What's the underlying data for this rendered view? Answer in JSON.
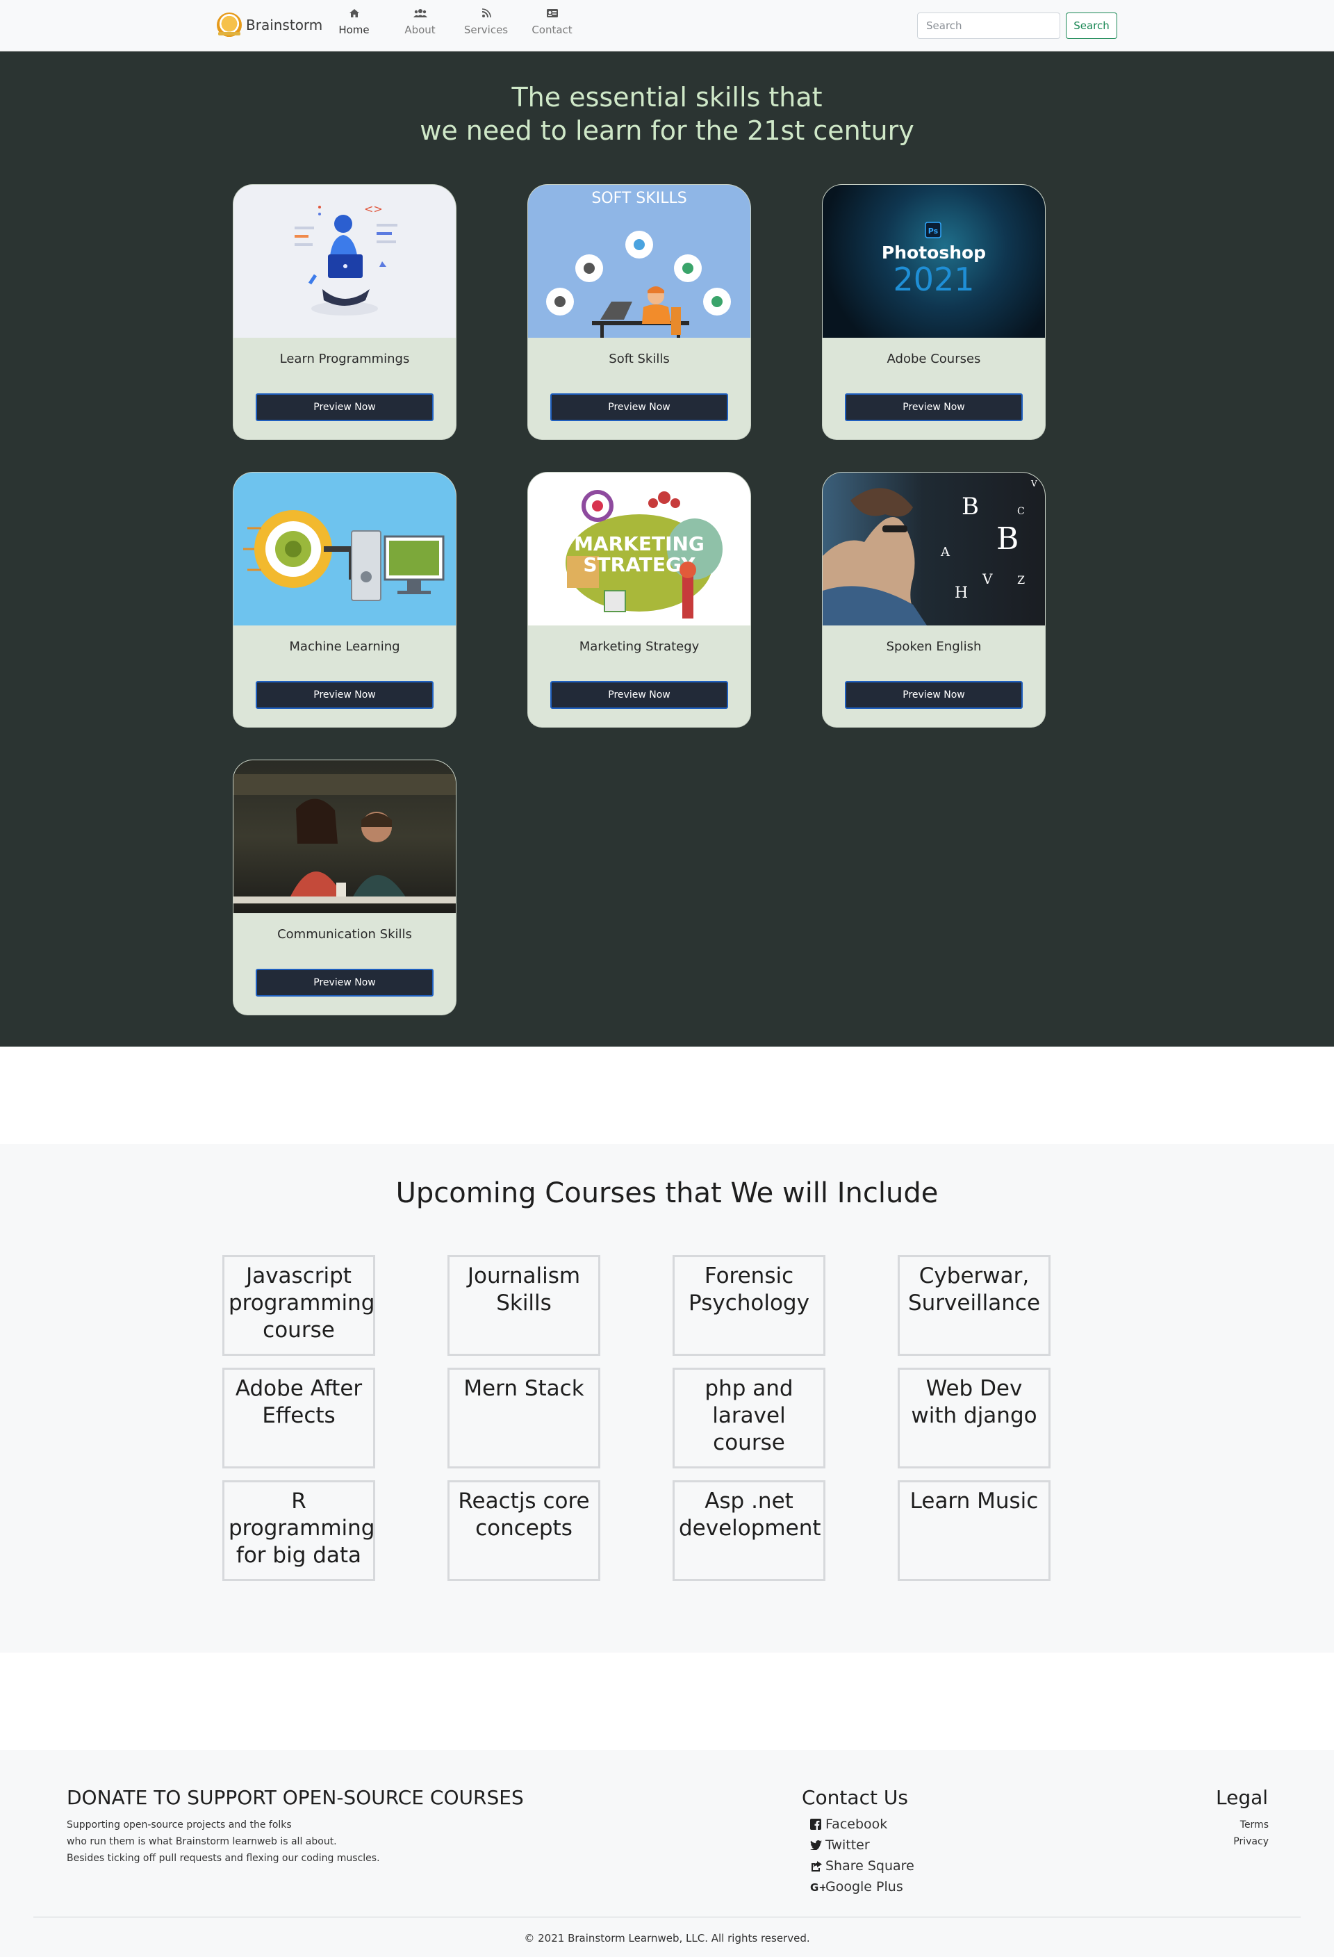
{
  "nav": {
    "brand": "Brainstorm",
    "items": [
      {
        "label": "Home",
        "icon": "home-icon"
      },
      {
        "label": "About",
        "icon": "users-icon"
      },
      {
        "label": "Services",
        "icon": "broadcast-icon"
      },
      {
        "label": "Contact",
        "icon": "id-card-icon"
      }
    ],
    "search_placeholder": "Search",
    "search_button": "Search"
  },
  "hero": {
    "title_line1": "The essential skills that",
    "title_line2": "we need to learn for the 21st century",
    "cards": [
      {
        "title": "Learn Programmings",
        "button": "Preview Now"
      },
      {
        "title": "Soft Skills",
        "button": "Preview Now",
        "image_text": "SOFT  SKILLS"
      },
      {
        "title": "Adobe Courses",
        "button": "Preview Now",
        "image_text_1": "Ps",
        "image_text_2": "Photoshop",
        "image_text_3": "2021"
      },
      {
        "title": "Machine Learning",
        "button": "Preview Now"
      },
      {
        "title": "Marketing Strategy",
        "button": "Preview Now",
        "image_text_1": "MARKETING",
        "image_text_2": "STRATEGY"
      },
      {
        "title": "Spoken English",
        "button": "Preview Now"
      },
      {
        "title": "Communication Skills",
        "button": "Preview Now"
      }
    ]
  },
  "upcoming": {
    "title": "Upcoming Courses that We will Include",
    "courses": [
      "Javascript programming course",
      "Journalism Skills",
      "Forensic Psychology",
      "Cyberwar, Surveillance",
      "Adobe After Effects",
      "Mern Stack",
      "php and laravel course",
      "Web Dev with django",
      "R programming for big data",
      "Reactjs core concepts",
      "Asp .net development",
      "Learn Music"
    ]
  },
  "footer": {
    "donate_title": "DONATE TO SUPPORT OPEN-SOURCE COURSES",
    "donate_line1": "Supporting open-source projects and the folks",
    "donate_line2": "who run them is what Brainstorm learnweb is all about.",
    "donate_line3": "Besides ticking off pull requests and flexing our coding muscles.",
    "contact_title": "Contact Us",
    "contact_links": [
      {
        "label": "Facebook",
        "icon": "facebook-icon"
      },
      {
        "label": "Twitter",
        "icon": "twitter-icon"
      },
      {
        "label": "Share Square",
        "icon": "share-square-icon"
      },
      {
        "label": "Google Plus",
        "icon": "google-plus-icon"
      }
    ],
    "legal_title": "Legal",
    "legal_links": [
      "Terms",
      "Privacy"
    ],
    "copyright": "© 2021 Brainstorm Learnweb, LLC. All rights reserved."
  }
}
